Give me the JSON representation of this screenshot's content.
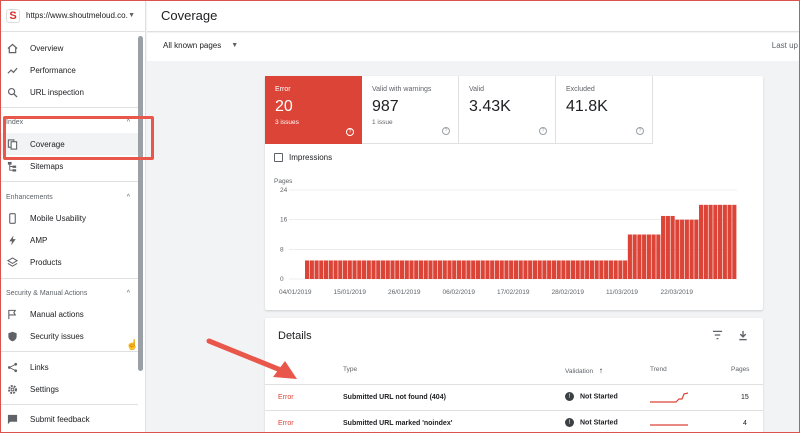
{
  "property": {
    "url": "https://www.shoutmeloud.co..."
  },
  "sidebar": {
    "overview": "Overview",
    "performance": "Performance",
    "url_inspection": "URL inspection",
    "index_section": "Index",
    "coverage": "Coverage",
    "sitemaps": "Sitemaps",
    "enhancements_section": "Enhancements",
    "mobile_usability": "Mobile Usability",
    "amp": "AMP",
    "products": "Products",
    "security_section": "Security & Manual Actions",
    "manual_actions": "Manual actions",
    "security_issues": "Security issues",
    "links": "Links",
    "settings": "Settings",
    "submit_feedback": "Submit feedback"
  },
  "header": {
    "title": "Coverage",
    "filter": "All known pages",
    "last_updated": "Last up"
  },
  "summary": {
    "tiles": [
      {
        "label": "Error",
        "value": "20",
        "sub": "3 issues"
      },
      {
        "label": "Valid with warnings",
        "value": "987",
        "sub": "1 issue"
      },
      {
        "label": "Valid",
        "value": "3.43K",
        "sub": ""
      },
      {
        "label": "Excluded",
        "value": "41.8K",
        "sub": ""
      }
    ],
    "impressions_label": "Impressions"
  },
  "chart_data": {
    "type": "bar",
    "ylabel": "Pages",
    "yticks": [
      0,
      8,
      16,
      24
    ],
    "ylim": [
      0,
      24
    ],
    "xtick_labels": [
      "04/01/2019",
      "15/01/2019",
      "26/01/2019",
      "06/02/2019",
      "17/02/2019",
      "28/02/2019",
      "11/03/2019",
      "22/03/2019"
    ],
    "color": "#db4437",
    "values": [
      5,
      5,
      5,
      5,
      5,
      5,
      5,
      5,
      5,
      5,
      5,
      5,
      5,
      5,
      5,
      5,
      5,
      5,
      5,
      5,
      5,
      5,
      5,
      5,
      5,
      5,
      5,
      5,
      5,
      5,
      5,
      5,
      5,
      5,
      5,
      5,
      5,
      5,
      5,
      5,
      5,
      5,
      5,
      5,
      5,
      5,
      5,
      5,
      5,
      5,
      5,
      5,
      5,
      5,
      5,
      5,
      5,
      5,
      5,
      5,
      5,
      5,
      5,
      5,
      5,
      5,
      5,
      5,
      12,
      12,
      12,
      12,
      12,
      12,
      12,
      17,
      17,
      17,
      16,
      16,
      16,
      16,
      16,
      20,
      20,
      20,
      20,
      20,
      20,
      20,
      20
    ]
  },
  "details": {
    "title": "Details",
    "columns": {
      "type": "Type",
      "validation": "Validation",
      "trend": "Trend",
      "pages": "Pages"
    },
    "rows": [
      {
        "status": "Error",
        "type": "Submitted URL not found (404)",
        "validation": "Not Started",
        "pages": "15"
      },
      {
        "status": "Error",
        "type": "Submitted URL marked 'noindex'",
        "validation": "Not Started",
        "pages": "4"
      }
    ]
  }
}
